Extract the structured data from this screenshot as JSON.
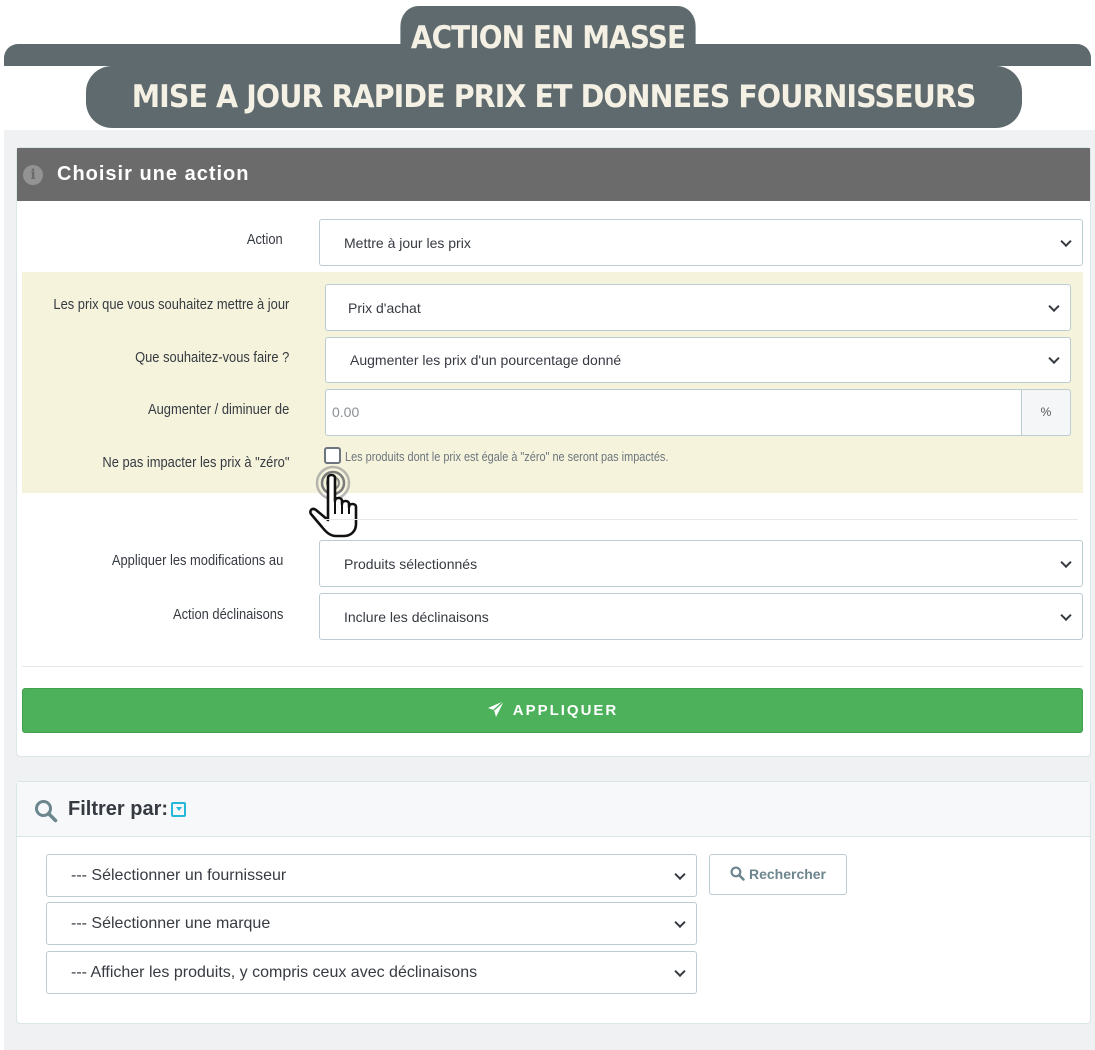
{
  "banner": {
    "top": "ACTION EN MASSE",
    "main": "MISE A JOUR RAPIDE  PRIX ET DONNEES FOURNISSEURS"
  },
  "action_panel": {
    "title": "Choisir une action",
    "icon": "info-icon",
    "action": {
      "label": "Action",
      "value": "Mettre à jour les prix"
    },
    "prices_to_update": {
      "label": "Les prix que vous souhaitez mettre à jour",
      "value": "Prix d'achat"
    },
    "what_to_do": {
      "label": "Que souhaitez-vous faire ?",
      "value": "Augmenter les prix d'un pourcentage donné"
    },
    "amount": {
      "label": "Augmenter / diminuer de",
      "placeholder": "0.00",
      "addon": "%"
    },
    "zero_prices": {
      "label": "Ne pas impacter les prix à \"zéro\"",
      "help": "Les produits dont le prix est égale à \"zéro\" ne seront pas impactés.",
      "checked": false
    },
    "apply_to": {
      "label": "Appliquer les modifications au",
      "value": "Produits sélectionnés"
    },
    "combinations": {
      "label": "Action déclinaisons",
      "value": "Inclure les déclinaisons"
    },
    "apply_button": "APPLIQUER",
    "apply_color": "#4cb15a",
    "highlight_color": "#f5f3dc"
  },
  "filter_panel": {
    "title": "Filtrer par:",
    "supplier": "--- Sélectionner un fournisseur",
    "brand": "--- Sélectionner une marque",
    "products": "--- Afficher les produits, y compris ceux avec déclinaisons",
    "search_button": "Rechercher"
  }
}
